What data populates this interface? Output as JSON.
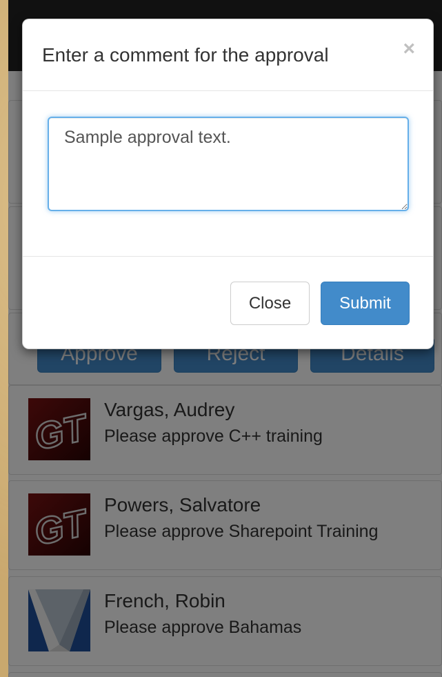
{
  "modal": {
    "title": "Enter a comment for the approval",
    "close_symbol": "×",
    "comment_value": "Sample approval text.",
    "close_button": "Close",
    "submit_button": "Submit"
  },
  "background_actions": [
    {
      "label": "Approve"
    },
    {
      "label": "Reject"
    },
    {
      "label": "Details"
    }
  ],
  "approvals": [
    {
      "name": "Vargas, Audrey",
      "description": "Please approve C++ training",
      "avatar": "gt-logo-icon"
    },
    {
      "name": "Powers, Salvatore",
      "description": "Please approve Sharepoint Training",
      "avatar": "gt-logo-icon"
    },
    {
      "name": "French, Robin",
      "description": "Please approve Bahamas",
      "avatar": "v-logo-icon"
    }
  ],
  "colors": {
    "primary": "#428bca",
    "navbar": "#222222",
    "focus_border": "#66afe9",
    "gt_avatar": "#5a0d0d"
  }
}
